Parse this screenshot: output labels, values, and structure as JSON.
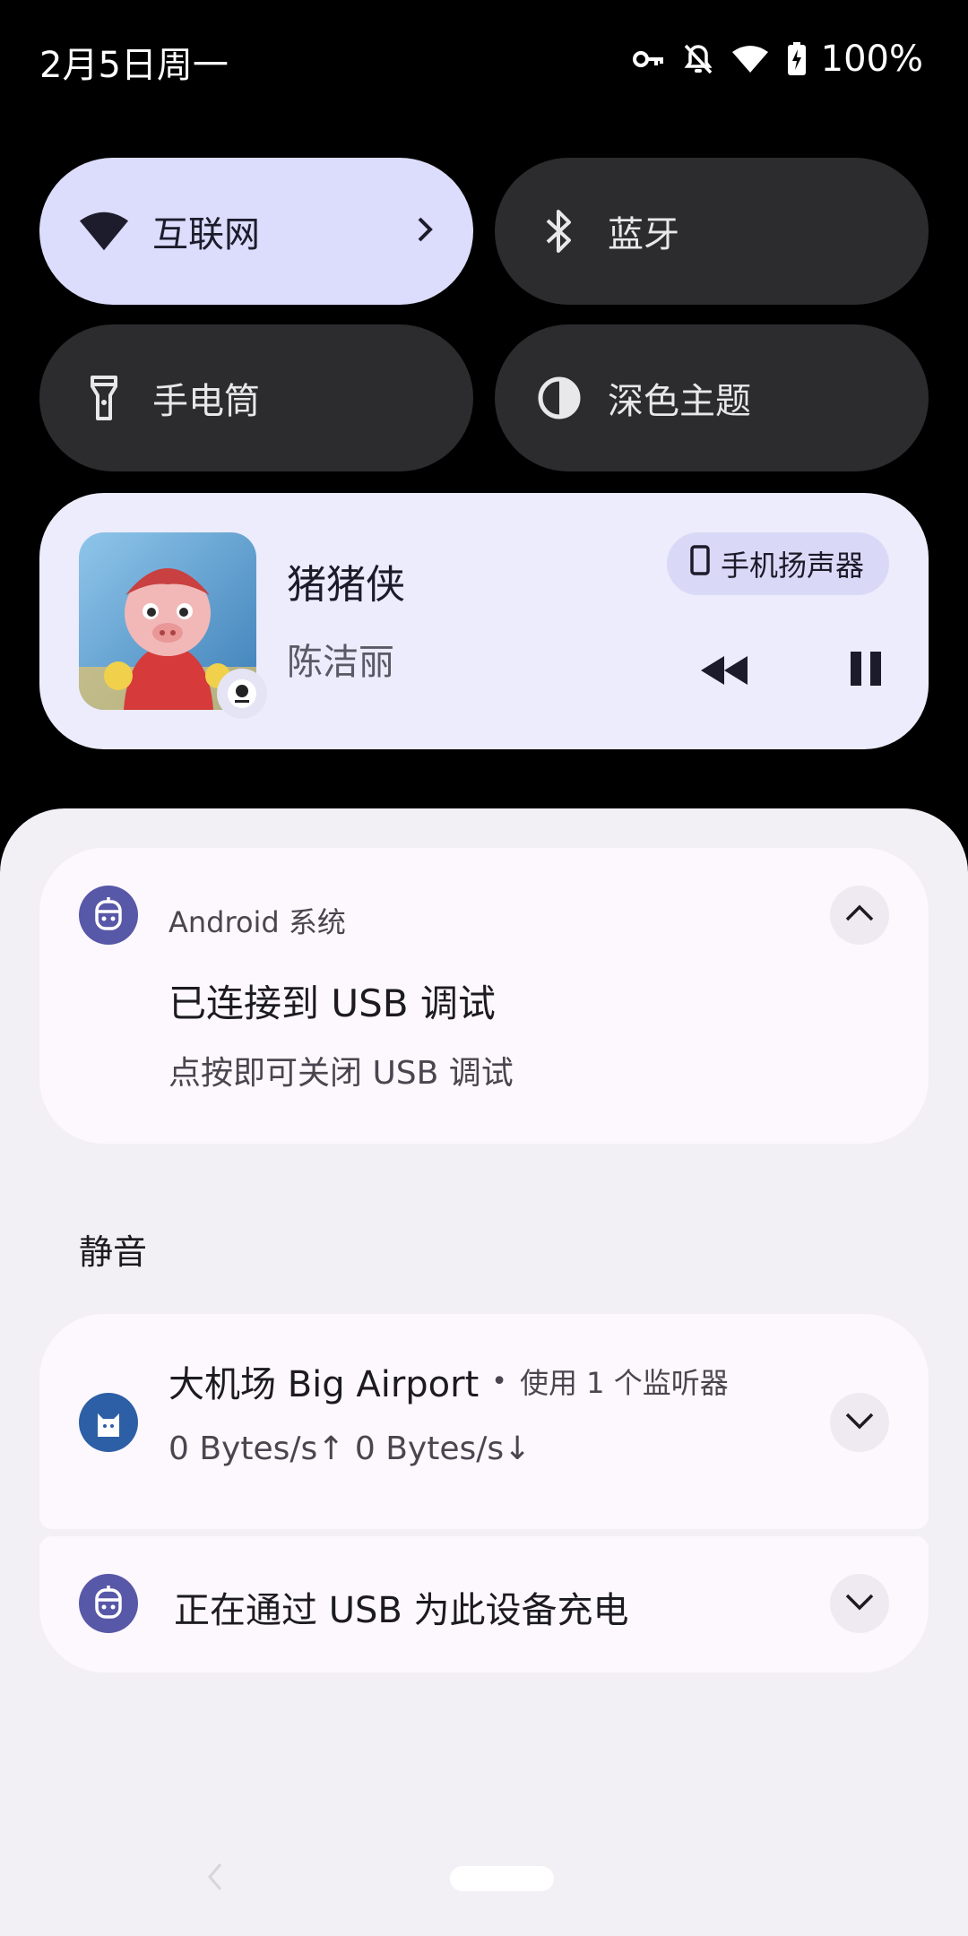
{
  "status_bar": {
    "date": "2月5日周一",
    "battery": "100%",
    "icons": [
      "vpn-key-icon",
      "bell-off-icon",
      "wifi-icon",
      "battery-charging-icon"
    ]
  },
  "quick_tiles": [
    {
      "label": "互联网",
      "icon": "wifi-icon",
      "active": true
    },
    {
      "label": "蓝牙",
      "icon": "bluetooth-icon",
      "active": false
    },
    {
      "label": "手电筒",
      "icon": "flashlight-icon",
      "active": false
    },
    {
      "label": "深色主题",
      "icon": "contrast-icon",
      "active": false
    }
  ],
  "media": {
    "title": "猪猪侠",
    "artist": "陈洁丽",
    "output": "手机扬声器"
  },
  "notifications": {
    "usb_debug": {
      "app": "Android 系统",
      "title": "已连接到 USB 调试",
      "text": "点按即可关闭 USB 调试"
    },
    "silent_header": "静音",
    "airport": {
      "title": "大机场 Big Airport",
      "subtext": "使用 1 个监听器",
      "text": "0 Bytes/s↑ 0 Bytes/s↓"
    },
    "charging": {
      "title": "正在通过 USB 为此设备充电"
    }
  },
  "colors": {
    "tile_active": "#dcdcfc",
    "tile_inactive": "#2c2c2e",
    "media_bg": "#ececfc",
    "shade_bg": "#f2eff5",
    "android_icon": "#5858a8",
    "airport_icon": "#2d5fa6"
  }
}
